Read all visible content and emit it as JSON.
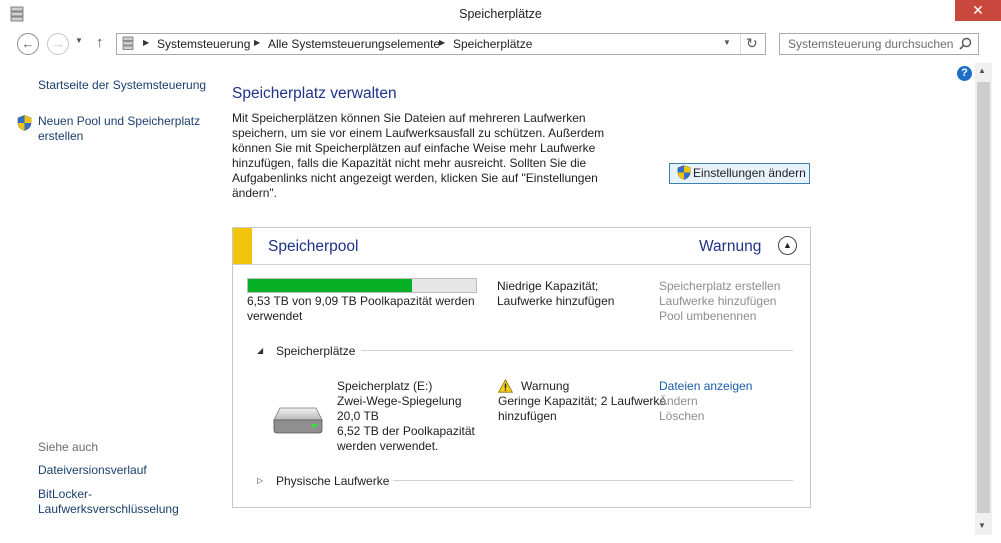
{
  "window": {
    "title": "Speicherplätze",
    "close_glyph": "✕"
  },
  "nav": {
    "back_glyph": "←",
    "forward_glyph": "→",
    "recent_glyph": "▼",
    "up_glyph": "↑",
    "breadcrumbs": [
      "Systemsteuerung",
      "Alle Systemsteuerungselemente",
      "Speicherplätze"
    ],
    "crumb_arrow": "▶",
    "dropdown_glyph": "▼",
    "refresh_glyph": "↻",
    "search_placeholder": "Systemsteuerung durchsuchen"
  },
  "left_pane": {
    "home_link": "Startseite der Systemsteuerung",
    "new_pool_link": "Neuen Pool und Speicherplatz erstellen",
    "see_also": "Siehe auch",
    "file_versions_link": "Dateiversionsverlauf",
    "bitlocker_link": "BitLocker-Laufwerksverschlüsselung"
  },
  "main": {
    "title": "Speicherplatz verwalten",
    "intro": "Mit Speicherplätzen können Sie Dateien auf mehreren Laufwerken speichern, um sie vor einem Laufwerksausfall zu schützen. Außerdem können Sie mit Speicherplätzen auf einfache Weise mehr Laufwerke hinzufügen, falls die Kapazität nicht mehr ausreicht. Sollten Sie die Aufgabenlinks nicht angezeigt werden, klicken Sie auf \"Einstellungen ändern\".",
    "settings_button": "Einstellungen ändern",
    "help_glyph": "?"
  },
  "pool": {
    "name": "Speicherpool",
    "status": "Warnung",
    "collapse_glyph": "▲",
    "capacity_fraction": 0.718,
    "capacity_text": "6,53 TB von 9,09 TB Poolkapazität werden verwendet",
    "warning_text": "Niedrige Kapazität; Laufwerke hinzufügen",
    "actions": {
      "create_space": "Speicherplatz erstellen",
      "add_drives": "Laufwerke hinzufügen",
      "rename_pool": "Pool umbenennen"
    },
    "spaces_section": {
      "label": "Speicherplätze",
      "arrow": "◢"
    },
    "space": {
      "name": "Speicherplatz (E:)",
      "type": "Zwei-Wege-Spiegelung",
      "size": "20,0 TB",
      "usage": "6,52 TB der Poolkapazität werden verwendet.",
      "status": "Warnung",
      "warning_detail": "Geringe Kapazität; 2 Laufwerke hinzufügen",
      "actions": {
        "show_files": "Dateien anzeigen",
        "change": "Ändern",
        "delete": "Löschen"
      }
    },
    "physical_section": {
      "label": "Physische Laufwerke",
      "arrow": "▷"
    }
  },
  "colors": {
    "accent": "#1e3287",
    "capacity_fill": "#06b025",
    "warning_stripe": "#f2c40e",
    "close_red": "#c9483d"
  }
}
